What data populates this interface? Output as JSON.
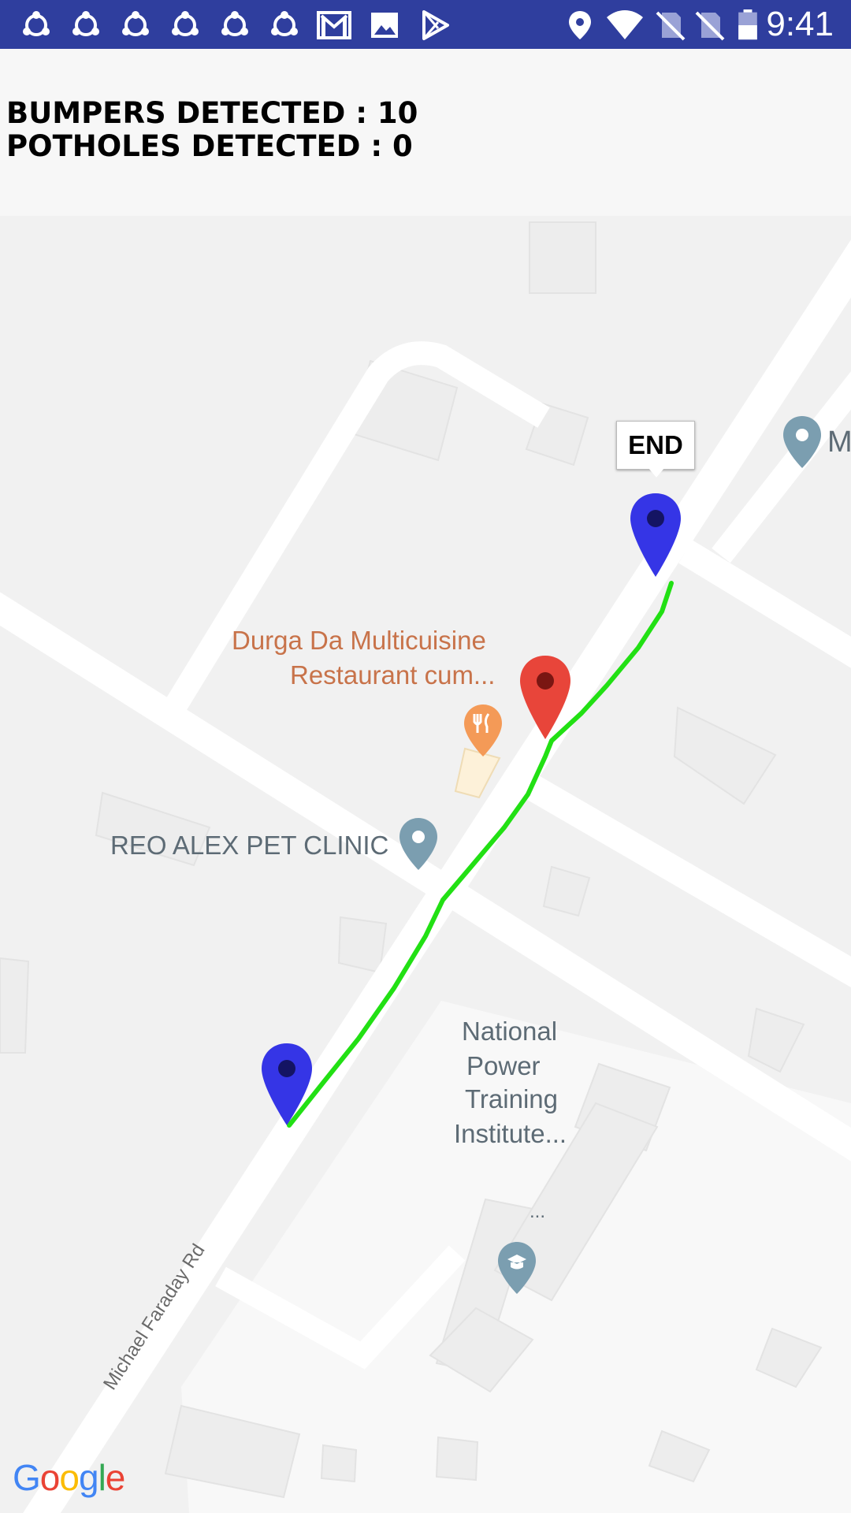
{
  "status_bar": {
    "time": "9:41",
    "left_icons": [
      "shareit-icon",
      "shareit-icon",
      "shareit-icon",
      "shareit-icon",
      "shareit-icon",
      "shareit-icon",
      "gmail-icon",
      "gallery-icon",
      "play-store-icon"
    ],
    "right_icons": [
      "location-icon",
      "wifi-icon",
      "no-sim-icon",
      "no-sim-icon",
      "battery-icon"
    ],
    "color": "#2f3e9e"
  },
  "stats": {
    "bumpers": "BUMPERS DETECTED : 10",
    "potholes": "POTHOLES DETECTED : 0"
  },
  "map": {
    "labels": {
      "restaurant_line1": "Durga Da Multicuisine",
      "restaurant_line2": "Restaurant cum...",
      "pet_clinic": "REO ALEX PET CLINIC",
      "institute_line1": "National",
      "institute_line2": "Power",
      "institute_line3": "Training",
      "institute_line4": "Institute...",
      "institute_ellipsis": "...",
      "road": "Michael Faraday Rd",
      "partial_label": "M"
    },
    "end_marker_label": "END",
    "route_color": "#22e014",
    "marker_blue": "#3535e6",
    "marker_red": "#e8453a",
    "google": [
      "G",
      "o",
      "o",
      "g",
      "l",
      "e"
    ]
  }
}
